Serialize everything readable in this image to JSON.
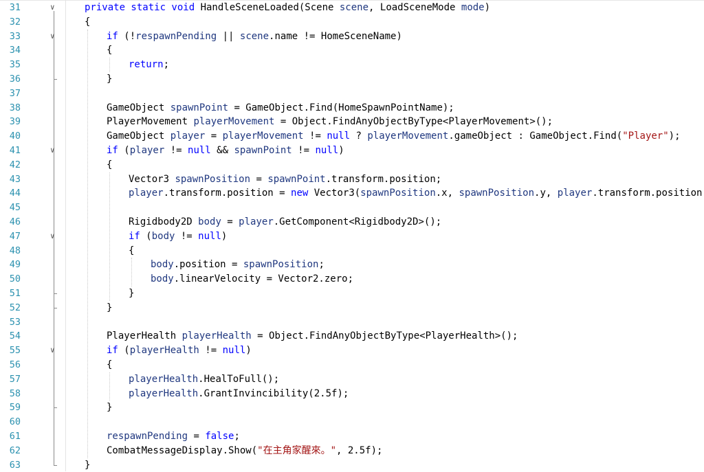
{
  "editor": {
    "language": "csharp",
    "colors": {
      "line_number": "#2b91af",
      "keyword": "#0000ff",
      "variable": "#1f377f",
      "string": "#a31515",
      "default": "#000000"
    },
    "lines": [
      {
        "n": "31",
        "fold": "open",
        "tokens": [
          [
            "k",
            "private static void "
          ],
          [
            "t",
            "HandleSceneLoaded(Scene "
          ],
          [
            "v",
            "scene"
          ],
          [
            "t",
            ", LoadSceneMode "
          ],
          [
            "v",
            "mode"
          ],
          [
            "t",
            ")"
          ]
        ]
      },
      {
        "n": "32",
        "tokens": [
          [
            "t",
            "{"
          ]
        ]
      },
      {
        "n": "33",
        "fold": "open",
        "tokens": [
          [
            "k",
            "if"
          ],
          [
            "t",
            " (!"
          ],
          [
            "v",
            "respawnPending"
          ],
          [
            "t",
            " || "
          ],
          [
            "v",
            "scene"
          ],
          [
            "t",
            ".name != HomeSceneName)"
          ]
        ]
      },
      {
        "n": "34",
        "tokens": [
          [
            "t",
            "{"
          ]
        ]
      },
      {
        "n": "35",
        "tokens": [
          [
            "k",
            "return"
          ],
          [
            "t",
            ";"
          ]
        ]
      },
      {
        "n": "36",
        "tokens": [
          [
            "t",
            "}"
          ]
        ]
      },
      {
        "n": "37",
        "tokens": []
      },
      {
        "n": "38",
        "tokens": [
          [
            "t",
            "GameObject "
          ],
          [
            "v",
            "spawnPoint"
          ],
          [
            "t",
            " = GameObject.Find(HomeSpawnPointName);"
          ]
        ]
      },
      {
        "n": "39",
        "tokens": [
          [
            "t",
            "PlayerMovement "
          ],
          [
            "v",
            "playerMovement"
          ],
          [
            "t",
            " = Object.FindAnyObjectByType<PlayerMovement>();"
          ]
        ]
      },
      {
        "n": "40",
        "tokens": [
          [
            "t",
            "GameObject "
          ],
          [
            "v",
            "player"
          ],
          [
            "t",
            " = "
          ],
          [
            "v",
            "playerMovement"
          ],
          [
            "t",
            " != "
          ],
          [
            "k",
            "null"
          ],
          [
            "t",
            " ? "
          ],
          [
            "v",
            "playerMovement"
          ],
          [
            "t",
            ".gameObject : GameObject.Find("
          ],
          [
            "s",
            "\"Player\""
          ],
          [
            "t",
            ");"
          ]
        ]
      },
      {
        "n": "41",
        "fold": "open",
        "tokens": [
          [
            "k",
            "if"
          ],
          [
            "t",
            " ("
          ],
          [
            "v",
            "player"
          ],
          [
            "t",
            " != "
          ],
          [
            "k",
            "null"
          ],
          [
            "t",
            " && "
          ],
          [
            "v",
            "spawnPoint"
          ],
          [
            "t",
            " != "
          ],
          [
            "k",
            "null"
          ],
          [
            "t",
            ")"
          ]
        ]
      },
      {
        "n": "42",
        "tokens": [
          [
            "t",
            "{"
          ]
        ]
      },
      {
        "n": "43",
        "tokens": [
          [
            "t",
            "Vector3 "
          ],
          [
            "v",
            "spawnPosition"
          ],
          [
            "t",
            " = "
          ],
          [
            "v",
            "spawnPoint"
          ],
          [
            "t",
            ".transform.position;"
          ]
        ]
      },
      {
        "n": "44",
        "tokens": [
          [
            "v",
            "player"
          ],
          [
            "t",
            ".transform.position = "
          ],
          [
            "k",
            "new"
          ],
          [
            "t",
            " Vector3("
          ],
          [
            "v",
            "spawnPosition"
          ],
          [
            "t",
            ".x, "
          ],
          [
            "v",
            "spawnPosition"
          ],
          [
            "t",
            ".y, "
          ],
          [
            "v",
            "player"
          ],
          [
            "t",
            ".transform.position.z);"
          ]
        ]
      },
      {
        "n": "45",
        "tokens": []
      },
      {
        "n": "46",
        "tokens": [
          [
            "t",
            "Rigidbody2D "
          ],
          [
            "v",
            "body"
          ],
          [
            "t",
            " = "
          ],
          [
            "v",
            "player"
          ],
          [
            "t",
            ".GetComponent<Rigidbody2D>();"
          ]
        ]
      },
      {
        "n": "47",
        "fold": "open",
        "tokens": [
          [
            "k",
            "if"
          ],
          [
            "t",
            " ("
          ],
          [
            "v",
            "body"
          ],
          [
            "t",
            " != "
          ],
          [
            "k",
            "null"
          ],
          [
            "t",
            ")"
          ]
        ]
      },
      {
        "n": "48",
        "tokens": [
          [
            "t",
            "{"
          ]
        ]
      },
      {
        "n": "49",
        "tokens": [
          [
            "v",
            "body"
          ],
          [
            "t",
            ".position = "
          ],
          [
            "v",
            "spawnPosition"
          ],
          [
            "t",
            ";"
          ]
        ]
      },
      {
        "n": "50",
        "tokens": [
          [
            "v",
            "body"
          ],
          [
            "t",
            ".linearVelocity = Vector2.zero;"
          ]
        ]
      },
      {
        "n": "51",
        "tokens": [
          [
            "t",
            "}"
          ]
        ]
      },
      {
        "n": "52",
        "tokens": [
          [
            "t",
            "}"
          ]
        ]
      },
      {
        "n": "53",
        "tokens": []
      },
      {
        "n": "54",
        "tokens": [
          [
            "t",
            "PlayerHealth "
          ],
          [
            "v",
            "playerHealth"
          ],
          [
            "t",
            " = Object.FindAnyObjectByType<PlayerHealth>();"
          ]
        ]
      },
      {
        "n": "55",
        "fold": "open",
        "tokens": [
          [
            "k",
            "if"
          ],
          [
            "t",
            " ("
          ],
          [
            "v",
            "playerHealth"
          ],
          [
            "t",
            " != "
          ],
          [
            "k",
            "null"
          ],
          [
            "t",
            ")"
          ]
        ]
      },
      {
        "n": "56",
        "tokens": [
          [
            "t",
            "{"
          ]
        ]
      },
      {
        "n": "57",
        "tokens": [
          [
            "v",
            "playerHealth"
          ],
          [
            "t",
            ".HealToFull();"
          ]
        ]
      },
      {
        "n": "58",
        "tokens": [
          [
            "v",
            "playerHealth"
          ],
          [
            "t",
            ".GrantInvincibility(2.5f);"
          ]
        ]
      },
      {
        "n": "59",
        "tokens": [
          [
            "t",
            "}"
          ]
        ]
      },
      {
        "n": "60",
        "tokens": []
      },
      {
        "n": "61",
        "tokens": [
          [
            "v",
            "respawnPending"
          ],
          [
            "t",
            " = "
          ],
          [
            "k",
            "false"
          ],
          [
            "t",
            ";"
          ]
        ]
      },
      {
        "n": "62",
        "tokens": [
          [
            "t",
            "CombatMessageDisplay.Show("
          ],
          [
            "s",
            "\"在主角家醒來。\""
          ],
          [
            "t",
            ", 2.5f);"
          ]
        ]
      },
      {
        "n": "63",
        "tokens": [
          [
            "t",
            "}"
          ]
        ]
      }
    ]
  }
}
